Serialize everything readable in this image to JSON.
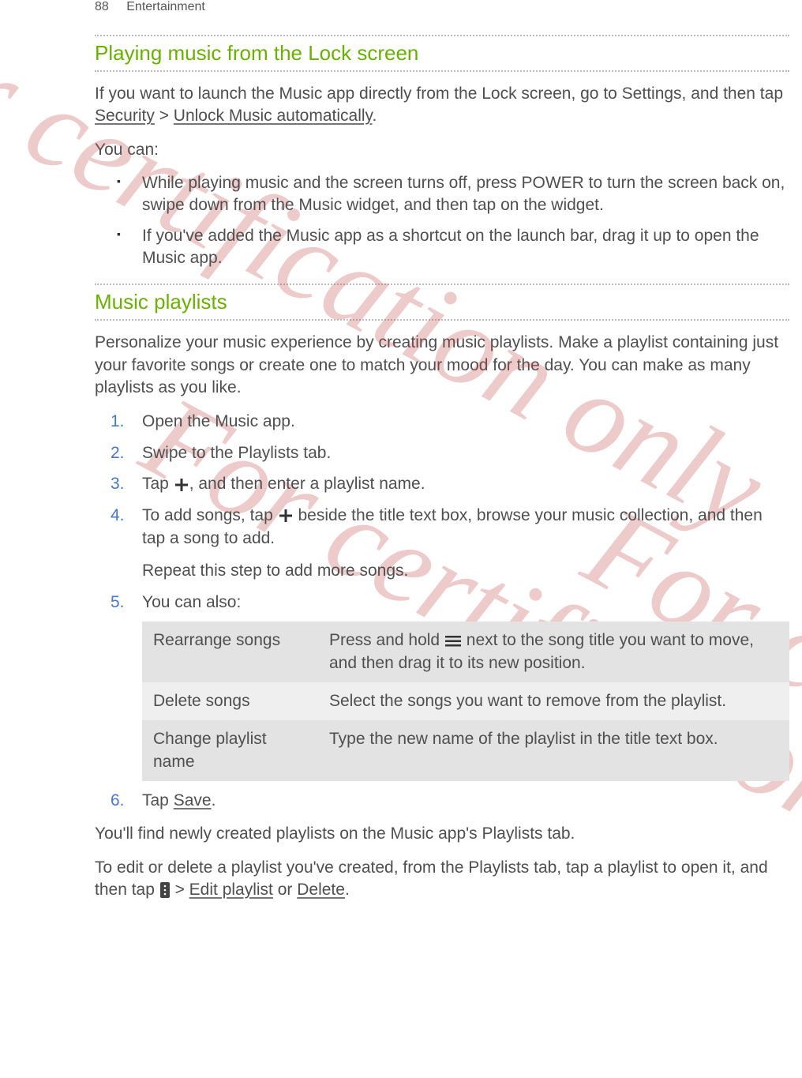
{
  "header": {
    "page_number": "88",
    "chapter": "Entertainment"
  },
  "watermark": "For certification only",
  "section1": {
    "title": "Playing music from the Lock screen",
    "intro_a": "If you want to launch the Music app directly from the Lock screen, go to Settings, and then tap ",
    "intro_security": "Security",
    "intro_gt": " > ",
    "intro_unlock": "Unlock Music automatically",
    "intro_period": ".",
    "youcan": "You can:",
    "bullet1": "While playing music and the screen turns off, press POWER to turn the screen back on, swipe down from the Music widget, and then tap on the widget.",
    "bullet2": "If you've added the Music app as a shortcut on the launch bar, drag it up to open the Music app."
  },
  "section2": {
    "title": "Music playlists",
    "intro": "Personalize your music experience by creating music playlists. Make a playlist containing just your favorite songs or create one to match your mood for the day. You can make as many playlists as you like.",
    "steps": {
      "s1": "Open the Music app.",
      "s2": "Swipe to the Playlists tab.",
      "s3a": "Tap ",
      "s3b": ", and then enter a playlist name.",
      "s4a": "To add songs, tap ",
      "s4b": " beside the title text box, browse your music collection, and then tap a song to add.",
      "s4sub": "Repeat this step to add more songs.",
      "s5": "You can also:",
      "s6a": "Tap ",
      "s6save": "Save",
      "s6b": "."
    },
    "table": {
      "r1_label": "Rearrange songs",
      "r1_a": "Press and hold ",
      "r1_b": " next to the song title you want to move, and then drag it to its new position.",
      "r2_label": "Delete songs",
      "r2_text": "Select the songs you want to remove from the playlist.",
      "r3_label": "Change playlist name",
      "r3_text": "Type the new name of the playlist in the title text box."
    },
    "outro1": "You'll find newly created playlists on the Music app's Playlists tab.",
    "outro2a": "To edit or delete a playlist you've created, from the Playlists tab, tap a playlist to open it, and then tap ",
    "outro2b": " > ",
    "outro2edit": "Edit playlist",
    "outro2or": " or ",
    "outro2delete": "Delete",
    "outro2period": "."
  },
  "nums": {
    "n1": "1.",
    "n2": "2.",
    "n3": "3.",
    "n4": "4.",
    "n5": "5.",
    "n6": "6."
  }
}
